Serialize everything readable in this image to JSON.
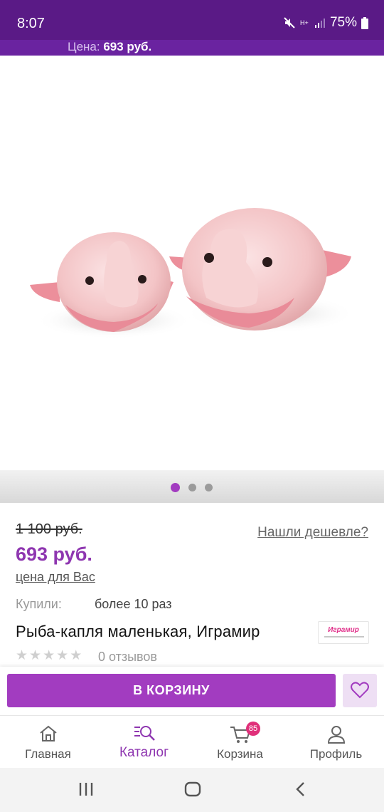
{
  "status_bar": {
    "time": "8:07",
    "battery": "75%",
    "network": "H+"
  },
  "price_strip": {
    "label": "Цена:",
    "value": "693 руб."
  },
  "carousel": {
    "count": 3,
    "active": 0
  },
  "product": {
    "old_price": "1 100 руб.",
    "cheaper_link": "Нашли дешевле?",
    "price": "693 руб.",
    "price_for_you": "цена для Вас",
    "bought_label": "Купили:",
    "bought_value": "более 10 раз",
    "title": "Рыба-капля маленькая, Играмир",
    "brand_logo": {
      "part1": "Игра",
      "part2": "мир"
    },
    "rating": 0,
    "reviews": "0 отзывов"
  },
  "actions": {
    "cart_label": "В КОРЗИНУ",
    "favorite_icon": "heart-icon"
  },
  "bottom_nav": {
    "items": [
      {
        "label": "Главная",
        "icon": "home-icon"
      },
      {
        "label": "Каталог",
        "icon": "catalog-search-icon"
      },
      {
        "label": "Корзина",
        "icon": "cart-icon",
        "badge": "85"
      },
      {
        "label": "Профиль",
        "icon": "profile-icon"
      }
    ],
    "active": 1
  },
  "colors": {
    "brand_purple": "#a23cc0",
    "status_bar": "#5a1a86",
    "price_text": "#8e36b0",
    "badge": "#e0307a"
  }
}
